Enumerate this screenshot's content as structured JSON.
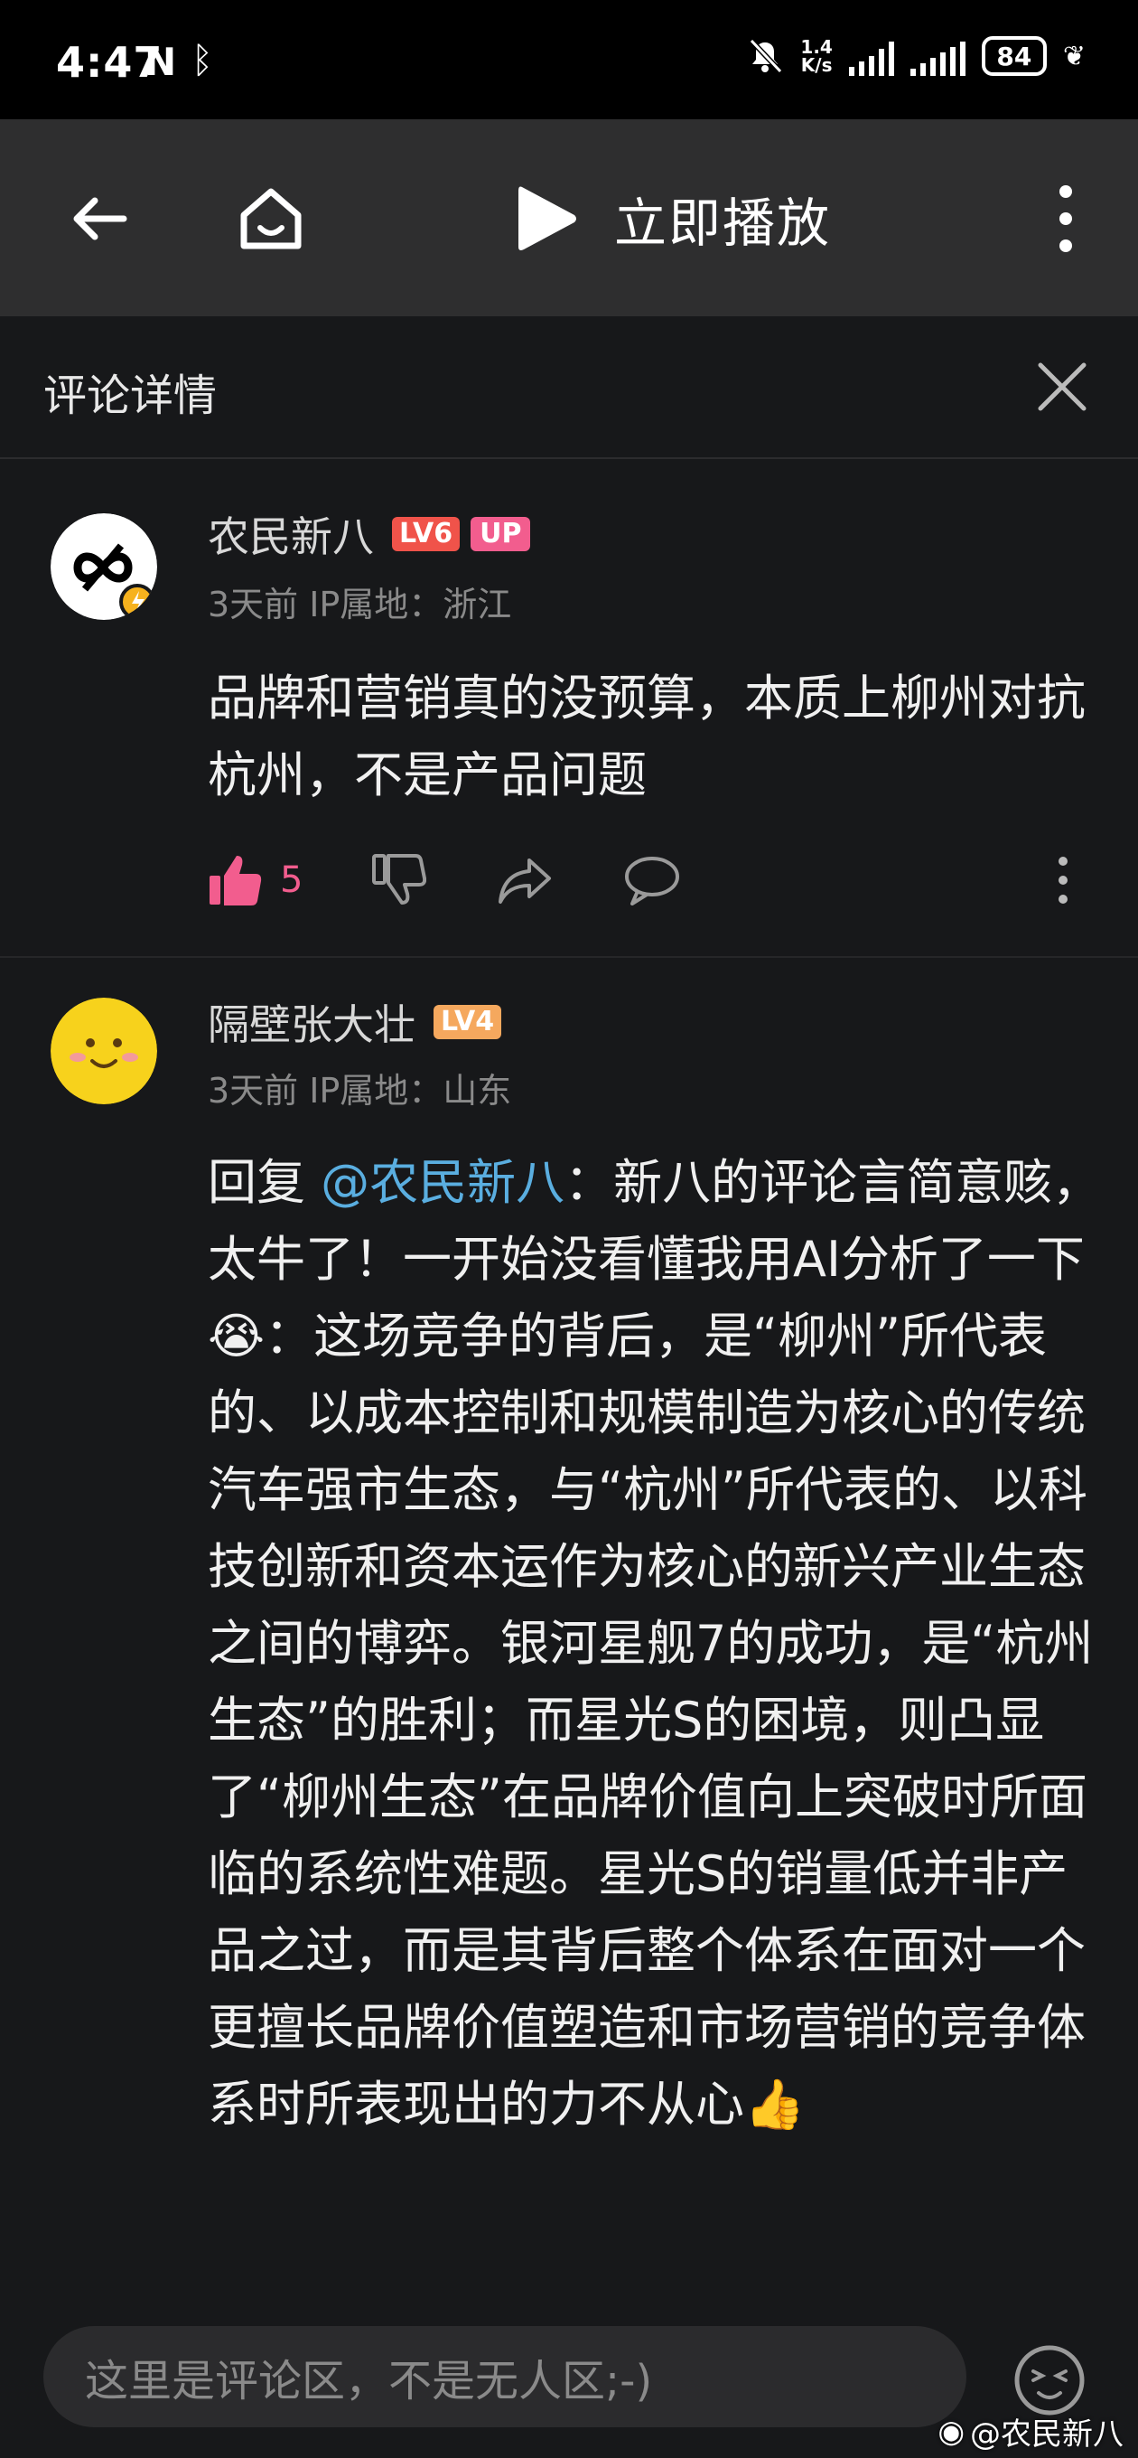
{
  "status": {
    "time": "4:47",
    "net_speed_top": "1.4",
    "net_speed_bottom": "K/s",
    "battery": "84"
  },
  "toolbar": {
    "play_label": "立即播放"
  },
  "panel": {
    "title": "评论详情"
  },
  "comments": [
    {
      "username": "农民新八",
      "level": "LV6",
      "level_color": "#f0534a",
      "badge": "UP",
      "time": "3天前",
      "ip": "IP属地：浙江",
      "text": "品牌和营销真的没预算，本质上柳州对抗杭州，不是产品问题",
      "likes": "5"
    },
    {
      "username": "隔壁张大壮",
      "level": "LV4",
      "level_color": "#f5a85e",
      "time": "3天前",
      "ip": "IP属地：山东",
      "reply_prefix": "回复 ",
      "mention": "@农民新八",
      "text_part1": "：新八的评论言简意赅，太牛了！一开始没看懂我用AI分析了一下",
      "text_part2": "：这场竞争的背后，是“柳州”所代表的、以成本控制和规模制造为核心的传统汽车强市生态，与“杭州”所代表的、以科技创新和资本运作为核心的新兴产业生态之间的博弈。银河星舰7的成功，是“杭州生态”的胜利；而星光S的困境，则凸显了“柳州生态”在品牌价值向上突破时所面临的系统性难题。星光S的销量低并非产品之过，而是其背后整个体系在面对一个更擅长品牌价值塑造和市场营销的竞争体系时所表现出的力不从心",
      "emoji_inline": "😭",
      "emoji_end": "👍"
    }
  ],
  "input": {
    "placeholder": "这里是评论区，不是无人区;-)"
  },
  "watermark": "@农民新八"
}
